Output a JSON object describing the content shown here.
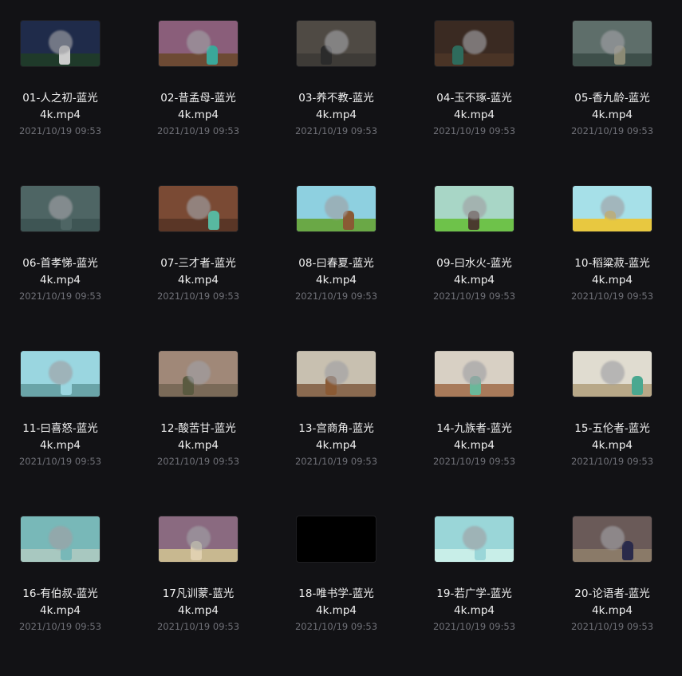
{
  "files": [
    {
      "name_line1": "01-人之初-蓝光",
      "name_line2": "4k.mp4",
      "date": "2021/10/19 09:53",
      "thumb_bg": "#1f2b4a",
      "ground": "#1f3a2a",
      "fig": "#ccc"
    },
    {
      "name_line1": "02-昔孟母-蓝光",
      "name_line2": "4k.mp4",
      "date": "2021/10/19 09:53",
      "thumb_bg": "#8a5e7a",
      "ground": "#6d4a34",
      "fig": "#3aa89a"
    },
    {
      "name_line1": "03-养不教-蓝光",
      "name_line2": "4k.mp4",
      "date": "2021/10/19 09:53",
      "thumb_bg": "#4f4a44",
      "ground": "#3e3b37",
      "fig": "#2b2b2b"
    },
    {
      "name_line1": "04-玉不琢-蓝光",
      "name_line2": "4k.mp4",
      "date": "2021/10/19 09:53",
      "thumb_bg": "#3a2a22",
      "ground": "#4a3426",
      "fig": "#2e6b5c"
    },
    {
      "name_line1": "05-香九龄-蓝光",
      "name_line2": "4k.mp4",
      "date": "2021/10/19 09:53",
      "thumb_bg": "#5e6e6a",
      "ground": "#3e4f4a",
      "fig": "#8b8a74"
    },
    {
      "name_line1": "06-首孝悌-蓝光",
      "name_line2": "4k.mp4",
      "date": "2021/10/19 09:53",
      "thumb_bg": "#4e6564",
      "ground": "#3e5554",
      "fig": "#4e6564"
    },
    {
      "name_line1": "07-三才者-蓝光",
      "name_line2": "4k.mp4",
      "date": "2021/10/19 09:53",
      "thumb_bg": "#7a4a34",
      "ground": "#5a3626",
      "fig": "#58b8a0"
    },
    {
      "name_line1": "08-曰春夏-蓝光",
      "name_line2": "4k.mp4",
      "date": "2021/10/19 09:53",
      "thumb_bg": "#8ed0e0",
      "ground": "#6aa846",
      "fig": "#8a5a34"
    },
    {
      "name_line1": "09-曰水火-蓝光",
      "name_line2": "4k.mp4",
      "date": "2021/10/19 09:53",
      "thumb_bg": "#a8d6c6",
      "ground": "#6ec24a",
      "fig": "#4a3a2e"
    },
    {
      "name_line1": "10-稻粱菽-蓝光",
      "name_line2": "4k.mp4",
      "date": "2021/10/19 09:53",
      "thumb_bg": "#a6e0e8",
      "ground": "#e8c840",
      "fig": "#e8c840"
    },
    {
      "name_line1": "11-曰喜怒-蓝光",
      "name_line2": "4k.mp4",
      "date": "2021/10/19 09:53",
      "thumb_bg": "#9ad6e0",
      "ground": "#6aa4a8",
      "fig": "#9ad6e0"
    },
    {
      "name_line1": "12-酸苦甘-蓝光",
      "name_line2": "4k.mp4",
      "date": "2021/10/19 09:53",
      "thumb_bg": "#a08878",
      "ground": "#7a6a58",
      "fig": "#5a5a40"
    },
    {
      "name_line1": "13-宫商角-蓝光",
      "name_line2": "4k.mp4",
      "date": "2021/10/19 09:53",
      "thumb_bg": "#c8c0b0",
      "ground": "#8a6a50",
      "fig": "#8a5a34"
    },
    {
      "name_line1": "14-九族者-蓝光",
      "name_line2": "4k.mp4",
      "date": "2021/10/19 09:53",
      "thumb_bg": "#d8d0c4",
      "ground": "#a87a5a",
      "fig": "#6ab89a"
    },
    {
      "name_line1": "15-五伦者-蓝光",
      "name_line2": "4k.mp4",
      "date": "2021/10/19 09:53",
      "thumb_bg": "#e0dcd0",
      "ground": "#b8a888",
      "fig": "#4aa890"
    },
    {
      "name_line1": "16-有伯叔-蓝光",
      "name_line2": "4k.mp4",
      "date": "2021/10/19 09:53",
      "thumb_bg": "#78b8b8",
      "ground": "#a8c8c0",
      "fig": "#78b8b8"
    },
    {
      "name_line1": "17凡训蒙-蓝光",
      "name_line2": "4k.mp4",
      "date": "2021/10/19 09:53",
      "thumb_bg": "#8a6a80",
      "ground": "#c8b890",
      "fig": "#e0d0b0"
    },
    {
      "name_line1": "18-唯书学-蓝光",
      "name_line2": "4k.mp4",
      "date": "2021/10/19 09:53",
      "thumb_bg": "#000000",
      "ground": "#000000",
      "fig": "#000000"
    },
    {
      "name_line1": "19-若广学-蓝光",
      "name_line2": "4k.mp4",
      "date": "2021/10/19 09:53",
      "thumb_bg": "#9ad6d8",
      "ground": "#c8eee8",
      "fig": "#9ad6d8"
    },
    {
      "name_line1": "20-论语者-蓝光",
      "name_line2": "4k.mp4",
      "date": "2021/10/19 09:53",
      "thumb_bg": "#6a5a58",
      "ground": "#8a7a68",
      "fig": "#2a2a4a"
    }
  ]
}
